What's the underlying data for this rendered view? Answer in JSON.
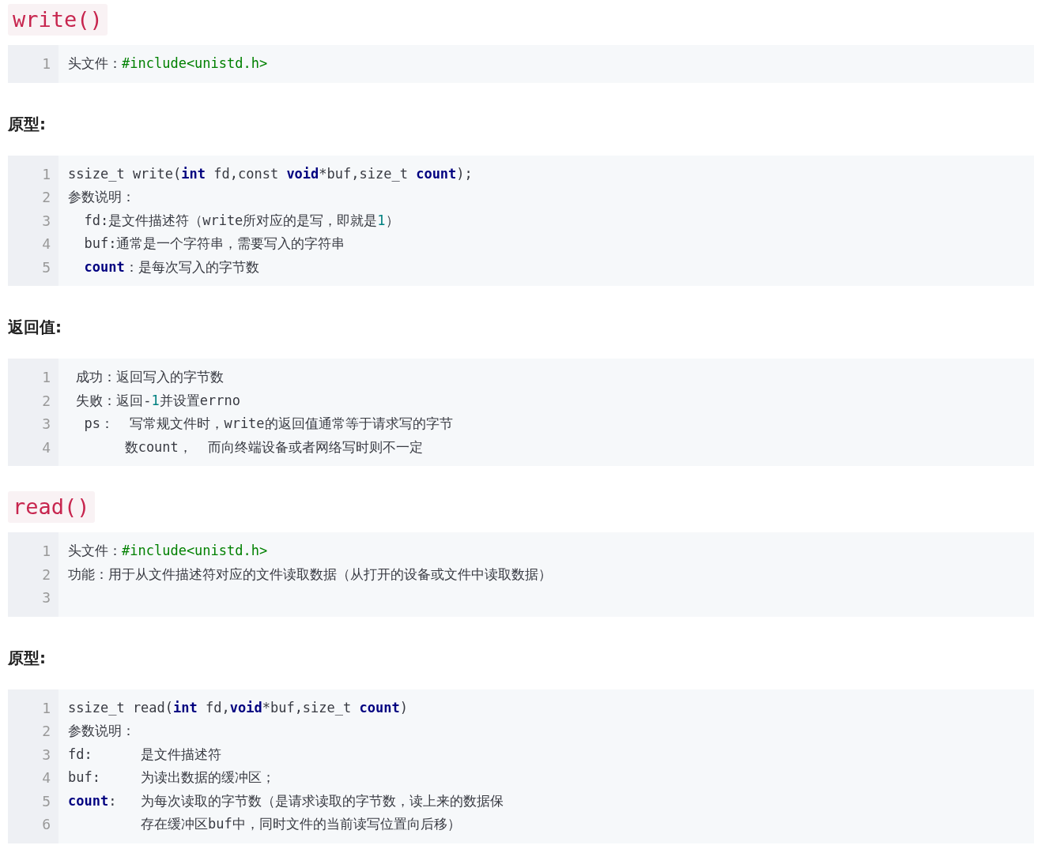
{
  "blocks": [
    {
      "kind": "heading",
      "text": "write()"
    },
    {
      "kind": "code",
      "lines": [
        {
          "number": "1",
          "tokens": [
            {
              "kind": "plain",
              "text": "头文件："
            },
            {
              "kind": "string",
              "text": "#include<unistd.h>"
            }
          ]
        }
      ]
    },
    {
      "kind": "label",
      "text": "原型:"
    },
    {
      "kind": "code",
      "lines": [
        {
          "number": "1",
          "tokens": [
            {
              "kind": "plain",
              "text": "ssize_t write("
            },
            {
              "kind": "keyword",
              "text": "int"
            },
            {
              "kind": "plain",
              "text": " fd,const "
            },
            {
              "kind": "keyword",
              "text": "void"
            },
            {
              "kind": "plain",
              "text": "*buf,size_t "
            },
            {
              "kind": "keyword",
              "text": "count"
            },
            {
              "kind": "plain",
              "text": ");"
            }
          ]
        },
        {
          "number": "2",
          "tokens": [
            {
              "kind": "plain",
              "text": "参数说明："
            }
          ]
        },
        {
          "number": "3",
          "indented": true,
          "tokens": [
            {
              "kind": "plain",
              "text": "fd:是文件描述符（write所对应的是写，即就是"
            },
            {
              "kind": "number",
              "text": "1"
            },
            {
              "kind": "plain",
              "text": "）"
            }
          ]
        },
        {
          "number": "4",
          "indented": true,
          "tokens": [
            {
              "kind": "plain",
              "text": "buf:通常是一个字符串，需要写入的字符串"
            }
          ]
        },
        {
          "number": "5",
          "indented": true,
          "tokens": [
            {
              "kind": "keyword",
              "text": "count"
            },
            {
              "kind": "plain",
              "text": "：是每次写入的字节数"
            }
          ]
        }
      ]
    },
    {
      "kind": "label",
      "text": "返回值:"
    },
    {
      "kind": "code",
      "lines": [
        {
          "number": "1",
          "tokens": [
            {
              "kind": "plain",
              "text": " 成功：返回写入的字节数"
            }
          ]
        },
        {
          "number": "2",
          "tokens": [
            {
              "kind": "plain",
              "text": " 失败：返回-"
            },
            {
              "kind": "number",
              "text": "1"
            },
            {
              "kind": "plain",
              "text": "并设置errno"
            }
          ]
        },
        {
          "number": "3",
          "tokens": [
            {
              "kind": "plain",
              "text": "  ps：  写常规文件时，write的返回值通常等于请求写的字节"
            }
          ]
        },
        {
          "number": "4",
          "tokens": [
            {
              "kind": "plain",
              "text": "       数count，  而向终端设备或者网络写时则不一定"
            }
          ]
        }
      ]
    },
    {
      "kind": "heading",
      "text": "read()"
    },
    {
      "kind": "code",
      "lines": [
        {
          "number": "1",
          "tokens": [
            {
              "kind": "plain",
              "text": "头文件："
            },
            {
              "kind": "string",
              "text": "#include<unistd.h>"
            }
          ]
        },
        {
          "number": "2",
          "tokens": [
            {
              "kind": "plain",
              "text": "功能：用于从文件描述符对应的文件读取数据（从打开的设备或文件中读取数据）"
            }
          ]
        },
        {
          "number": "3"
        }
      ]
    },
    {
      "kind": "label",
      "text": "原型:"
    },
    {
      "kind": "code",
      "lines": [
        {
          "number": "1",
          "tokens": [
            {
              "kind": "plain",
              "text": "ssize_t read("
            },
            {
              "kind": "keyword",
              "text": "int"
            },
            {
              "kind": "plain",
              "text": " fd,"
            },
            {
              "kind": "keyword",
              "text": "void"
            },
            {
              "kind": "plain",
              "text": "*buf,size_t "
            },
            {
              "kind": "keyword",
              "text": "count"
            },
            {
              "kind": "plain",
              "text": ")"
            }
          ]
        },
        {
          "number": "2",
          "tokens": [
            {
              "kind": "plain",
              "text": "参数说明："
            }
          ]
        },
        {
          "number": "3",
          "tokens": [
            {
              "kind": "plain",
              "text": "fd:      是文件描述符"
            }
          ]
        },
        {
          "number": "4",
          "tokens": [
            {
              "kind": "plain",
              "text": "buf:     为读出数据的缓冲区；"
            }
          ]
        },
        {
          "number": "5",
          "tokens": [
            {
              "kind": "keyword",
              "text": "count"
            },
            {
              "kind": "plain",
              "text": ":   为每次读取的字节数（是请求读取的字节数，读上来的数据保"
            }
          ]
        },
        {
          "number": "6",
          "tokens": [
            {
              "kind": "plain",
              "text": "         存在缓冲区buf中，同时文件的当前读写位置向后移）"
            }
          ]
        }
      ]
    }
  ]
}
